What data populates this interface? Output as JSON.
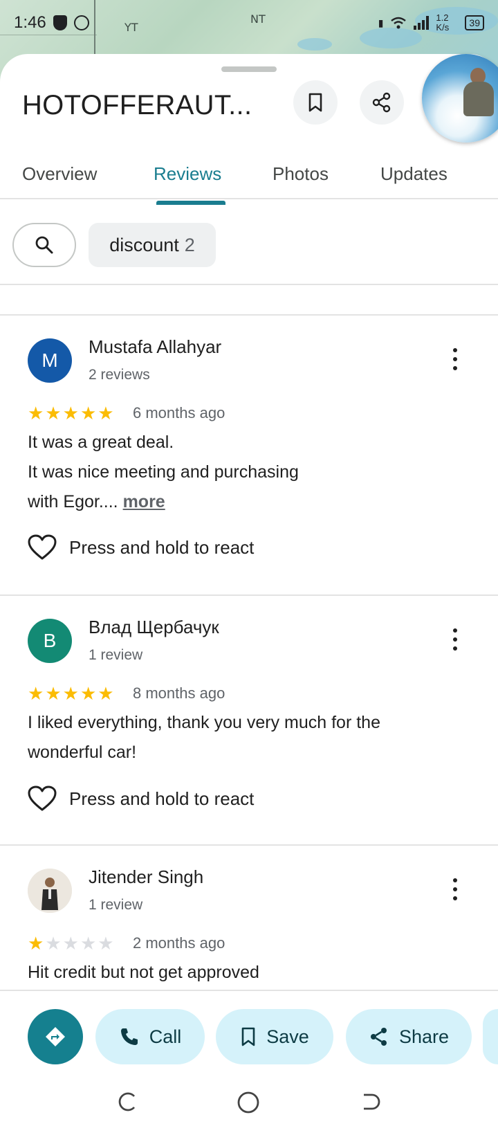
{
  "status_bar": {
    "time": "1:46",
    "speed": "1.2 K/s",
    "battery": "39"
  },
  "map": {
    "regions": [
      "YT",
      "NT"
    ]
  },
  "place": {
    "title": "HOTOFFERAUT..."
  },
  "tabs": [
    {
      "label": "Overview",
      "active": false
    },
    {
      "label": "Reviews",
      "active": true
    },
    {
      "label": "Photos",
      "active": false
    },
    {
      "label": "Updates",
      "active": false
    }
  ],
  "filters": {
    "chip_label": "discount",
    "chip_count": "2"
  },
  "reviews": [
    {
      "avatar_letter": "M",
      "avatar_color": "#1459a8",
      "name": "Mustafa Allahyar",
      "review_count": "2 reviews",
      "rating": 5,
      "date": "6 months ago",
      "text_lines": [
        "It was a great deal.",
        "It was nice meeting and purchasing",
        "with Egor...."
      ],
      "more_label": "more",
      "react_label": "Press and hold to react"
    },
    {
      "avatar_letter": "B",
      "avatar_color": "#138a74",
      "name": "Влад Щербачук",
      "review_count": "1 review",
      "rating": 5,
      "date": "8 months ago",
      "text_lines": [
        "I liked everything, thank you very much for the",
        "wonderful car!"
      ],
      "react_label": "Press and hold to react"
    },
    {
      "avatar_letter": "",
      "name": "Jitender Singh",
      "review_count": "1 review",
      "rating": 1,
      "date": "2 months ago",
      "text_lines": [
        "Hit credit but not get approved"
      ]
    }
  ],
  "actions": {
    "call": "Call",
    "save": "Save",
    "share": "Share"
  },
  "colors": {
    "accent": "#1a7d8f",
    "star": "#fbbc04",
    "pill_bg": "#d5f2fa"
  }
}
